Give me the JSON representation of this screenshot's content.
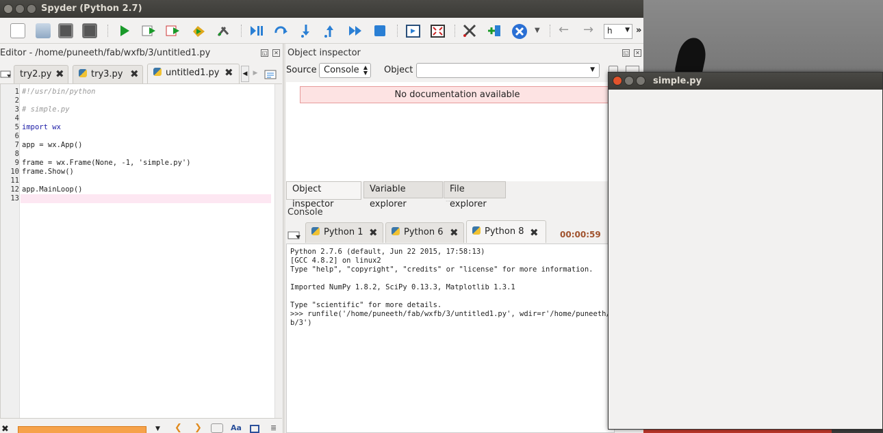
{
  "window": {
    "title": "Spyder (Python 2.7)"
  },
  "toolbar": {
    "search_value": "h",
    "more": "»"
  },
  "editor": {
    "title": "Editor - /home/puneeth/fab/wxfb/3/untitled1.py",
    "tabs": [
      {
        "label": "try2.py"
      },
      {
        "label": "try3.py"
      },
      {
        "label": "untitled1.py"
      }
    ],
    "lines": [
      {
        "n": "1",
        "text": "#!/usr/bin/python"
      },
      {
        "n": "2",
        "text": ""
      },
      {
        "n": "3",
        "text": "# simple.py"
      },
      {
        "n": "4",
        "text": ""
      },
      {
        "n": "5",
        "text": "import wx"
      },
      {
        "n": "6",
        "text": ""
      },
      {
        "n": "7",
        "text": "app = wx.App()"
      },
      {
        "n": "8",
        "text": ""
      },
      {
        "n": "9",
        "text": "frame = wx.Frame(None, -1, 'simple.py')"
      },
      {
        "n": "10",
        "text": "frame.Show()"
      },
      {
        "n": "11",
        "text": ""
      },
      {
        "n": "12",
        "text": "app.MainLoop()"
      },
      {
        "n": "13",
        "text": ""
      }
    ]
  },
  "inspector": {
    "title": "Object inspector",
    "source_label": "Source",
    "source_value": "Console",
    "object_label": "Object",
    "object_value": "",
    "message": "No documentation available",
    "bottom_tabs": [
      "Object inspector",
      "Variable explorer",
      "File explorer"
    ]
  },
  "console": {
    "title": "Console",
    "tabs": [
      "Python 1",
      "Python 6",
      "Python 8"
    ],
    "timer": "00:00:59",
    "lines": [
      "Python 2.7.6 (default, Jun 22 2015, 17:58:13)",
      "[GCC 4.8.2] on linux2",
      "Type \"help\", \"copyright\", \"credits\" or \"license\" for more information.",
      "",
      "Imported NumPy 1.8.2, SciPy 0.13.3, Matplotlib 1.3.1",
      "",
      "Type \"scientific\" for more details.",
      ">>> runfile('/home/puneeth/fab/wxfb/3/untitled1.py', wdir=r'/home/puneeth/",
      "b/3')"
    ]
  },
  "simple_window": {
    "title": "simple.py"
  }
}
